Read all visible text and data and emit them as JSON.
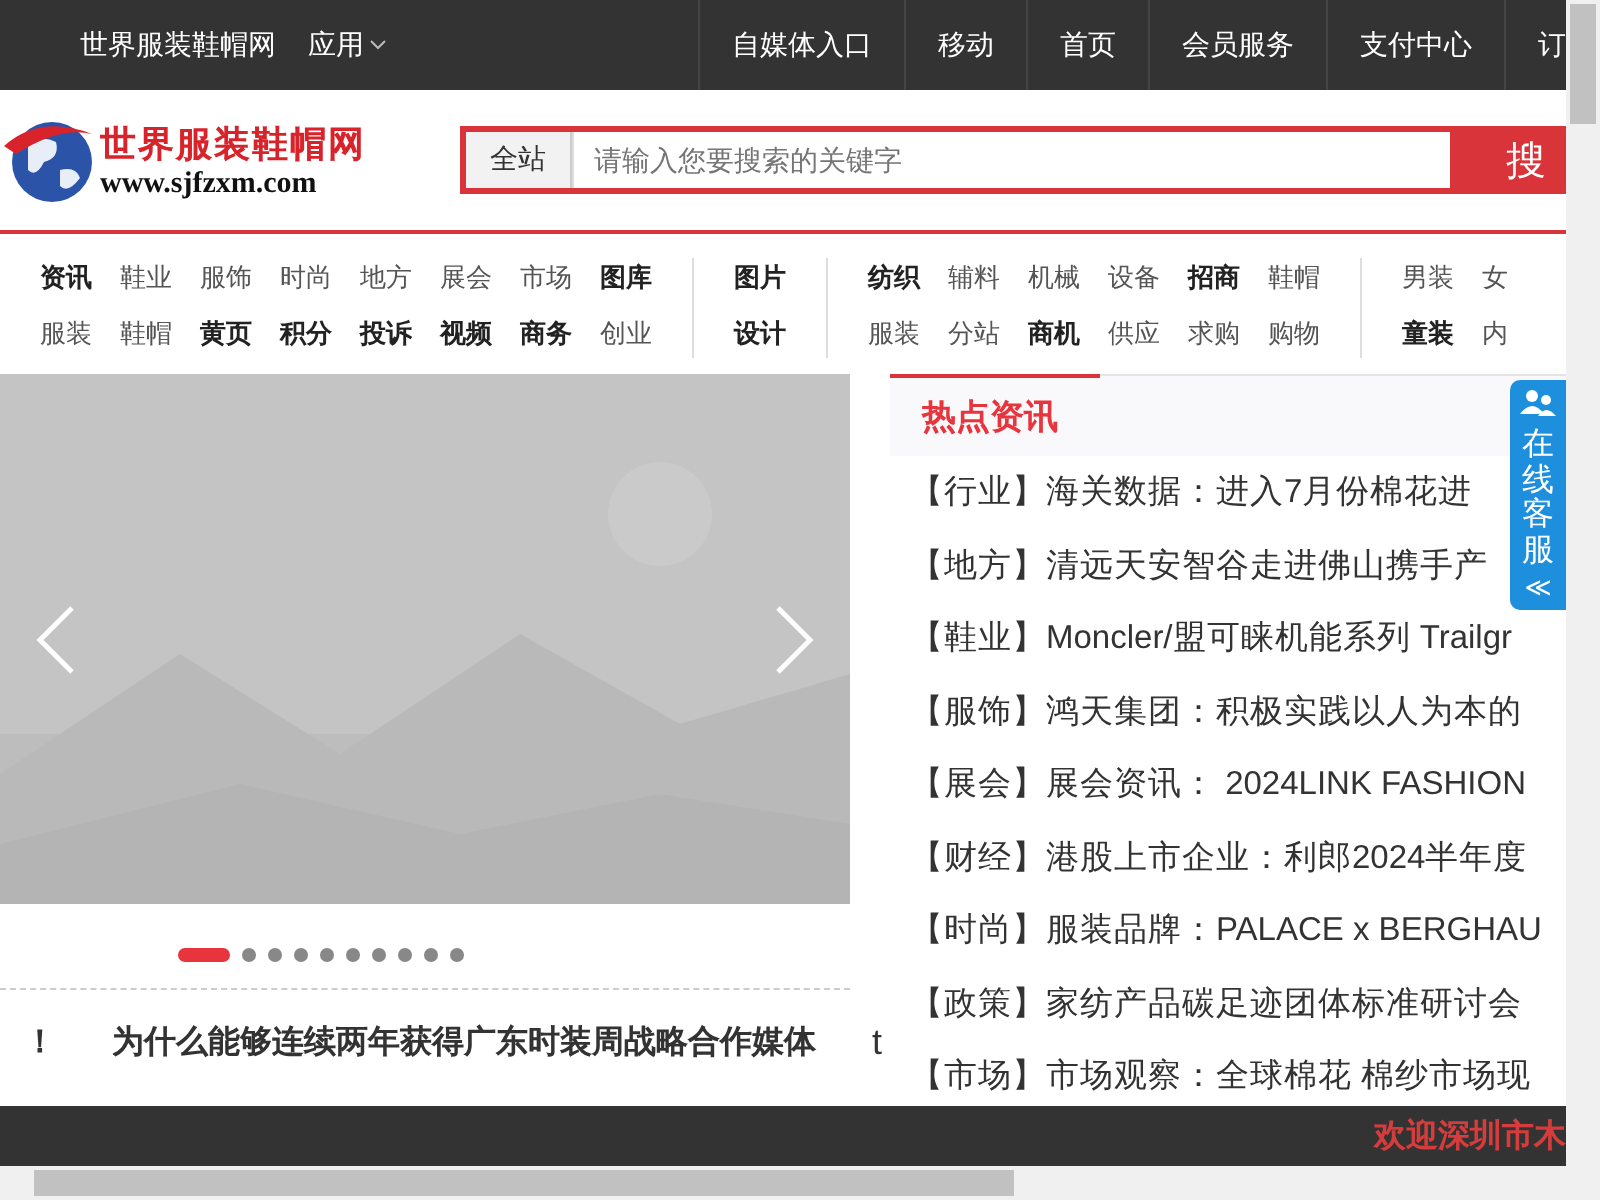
{
  "top_bar": {
    "site_name": "世界服装鞋帽网",
    "apps_menu": "应用",
    "links": [
      "自媒体入口",
      "移动",
      "首页",
      "会员服务",
      "支付中心",
      "订"
    ]
  },
  "logo": {
    "name": "世界服装鞋帽网",
    "url": "www.sjfzxm.com"
  },
  "search": {
    "scope": "全站",
    "placeholder": "请输入您要搜索的关键字",
    "button": "搜"
  },
  "category_nav": [
    {
      "columns": [
        [
          {
            "label": "资讯",
            "bold": true
          },
          {
            "label": "服装",
            "bold": false
          }
        ],
        [
          {
            "label": "鞋业",
            "bold": false
          },
          {
            "label": "鞋帽",
            "bold": false
          }
        ],
        [
          {
            "label": "服饰",
            "bold": false
          },
          {
            "label": "黄页",
            "bold": true
          }
        ],
        [
          {
            "label": "时尚",
            "bold": false
          },
          {
            "label": "积分",
            "bold": true
          }
        ],
        [
          {
            "label": "地方",
            "bold": false
          },
          {
            "label": "投诉",
            "bold": true
          }
        ],
        [
          {
            "label": "展会",
            "bold": false
          },
          {
            "label": "视频",
            "bold": true
          }
        ],
        [
          {
            "label": "市场",
            "bold": false
          },
          {
            "label": "商务",
            "bold": true
          }
        ],
        [
          {
            "label": "图库",
            "bold": true
          },
          {
            "label": "创业",
            "bold": false
          }
        ]
      ]
    },
    {
      "columns": [
        [
          {
            "label": "图片",
            "bold": true
          },
          {
            "label": "设计",
            "bold": true
          }
        ]
      ]
    },
    {
      "columns": [
        [
          {
            "label": "纺织",
            "bold": true
          },
          {
            "label": "服装",
            "bold": false
          }
        ],
        [
          {
            "label": "辅料",
            "bold": false
          },
          {
            "label": "分站",
            "bold": false
          }
        ],
        [
          {
            "label": "机械",
            "bold": false
          },
          {
            "label": "商机",
            "bold": true
          }
        ],
        [
          {
            "label": "设备",
            "bold": false
          },
          {
            "label": "供应",
            "bold": false
          }
        ],
        [
          {
            "label": "招商",
            "bold": true
          },
          {
            "label": "求购",
            "bold": false
          }
        ],
        [
          {
            "label": "鞋帽",
            "bold": false
          },
          {
            "label": "购物",
            "bold": false
          }
        ]
      ]
    },
    {
      "columns": [
        [
          {
            "label": "男装",
            "bold": false
          },
          {
            "label": "童装",
            "bold": true
          }
        ],
        [
          {
            "label": "女",
            "bold": false
          },
          {
            "label": "内",
            "bold": false
          }
        ]
      ]
    }
  ],
  "carousel": {
    "kind": "picture",
    "dots": [
      {
        "selected": true
      },
      {
        "selected": false
      },
      {
        "selected": false
      },
      {
        "selected": false
      },
      {
        "selected": false
      },
      {
        "selected": false
      },
      {
        "selected": false
      },
      {
        "selected": false
      },
      {
        "selected": false
      },
      {
        "selected": false
      }
    ]
  },
  "ticker": [
    "！",
    "为什么能够连续两年获得广东时装周战略合作媒体",
    "t"
  ],
  "hot_news": {
    "title": "热点资讯",
    "items": [
      {
        "category": "【行业】",
        "title": "海关数据：进入7月份棉花进"
      },
      {
        "category": "【地方】",
        "title": "清远天安智谷走进佛山携手产"
      },
      {
        "category": "【鞋业】",
        "title": "Moncler/盟可睐机能系列 Trailgr"
      },
      {
        "category": "【服饰】",
        "title": "鸿天集团：积极实践以人为本的"
      },
      {
        "category": "【展会】",
        "title": "展会资讯： 2024LINK FASHION"
      },
      {
        "category": "【财经】",
        "title": "港股上市企业：利郎2024半年度"
      },
      {
        "category": "【时尚】",
        "title": "服装品牌：PALACE x BERGHAU"
      },
      {
        "category": "【政策】",
        "title": "家纺产品碳足迹团体标准研讨会"
      },
      {
        "category": "【市场】",
        "title": "市场观察：全球棉花 棉纱市场现"
      }
    ]
  },
  "service_tab": {
    "label": "在线客服",
    "collapse": "≪"
  },
  "bottom_bar": {
    "message": "欢迎深圳市木"
  }
}
